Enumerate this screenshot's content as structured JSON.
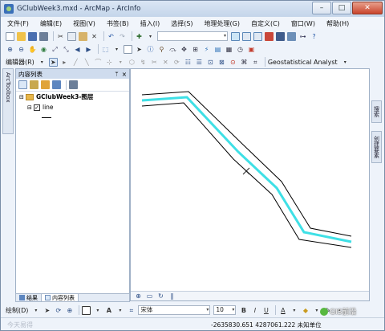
{
  "window": {
    "title": "GClubWeek3.mxd - ArcMap - ArcInfo",
    "min": "–",
    "max": "□",
    "close": "✕"
  },
  "menu": [
    "文件(F)",
    "编辑(E)",
    "视图(V)",
    "书签(B)",
    "插入(I)",
    "选择(S)",
    "地理处理(G)",
    "自定义(C)",
    "窗口(W)",
    "帮助(H)"
  ],
  "toolbar_editor": {
    "editor_label": "编辑器(R)",
    "geostat_label": "Geostatistical Analyst"
  },
  "left_dock": {
    "tab_label": "ArcToolbox"
  },
  "toc": {
    "title": "内容列表",
    "pin": "ᛘ",
    "close": "×",
    "group_name": "GClubWeek3-图层",
    "layer_name": "line",
    "tabs": [
      "结果",
      "内容列表"
    ]
  },
  "right_dock": {
    "tabs": [
      "搜索",
      "创建要素"
    ]
  },
  "drawing": {
    "label": "绘制(D)",
    "font_name": "宋体",
    "font_size": "10",
    "bold": "B",
    "italic": "I",
    "underline": "U",
    "font_color": "A"
  },
  "status": {
    "coordinates": "-2635830.651  4287061.222 未知单位"
  },
  "watermark": {
    "left": "今天易得",
    "right": "GIS前沿"
  },
  "colors": {
    "line_core": "#3fe0e6",
    "line_outline": "#000000",
    "panel_header": "#cfdcee"
  }
}
